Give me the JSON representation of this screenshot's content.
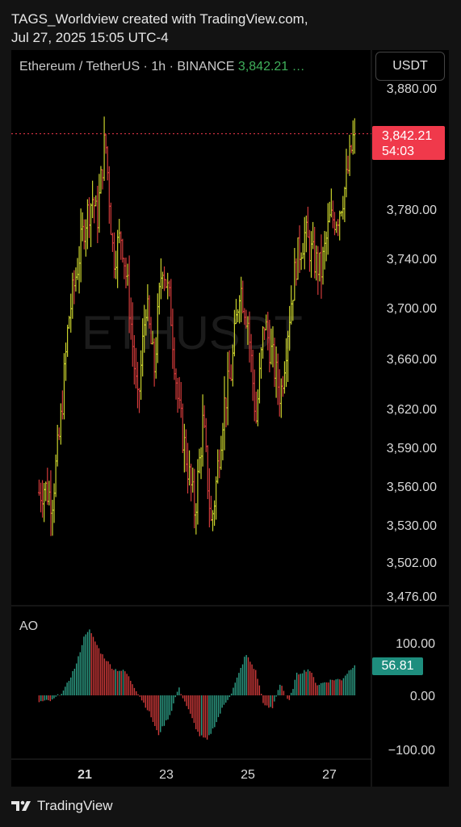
{
  "header": {
    "line1": "TAGS_Worldview created with TradingView.com,",
    "line2": "Jul 27, 2025 15:05 UTC-4"
  },
  "instrument": {
    "label": "Ethereum / TetherUS · 1h · BINANCE",
    "price": "3,842.21 …"
  },
  "currency_button": "USDT",
  "watermark": "ETHUSDT",
  "price_label": {
    "price": "3,842.21",
    "countdown": "54:03"
  },
  "ao": {
    "title": "AO",
    "value_label": "56.81"
  },
  "footer": {
    "brand": "TradingView"
  },
  "colors": {
    "up": "#c9d22c",
    "down": "#d03a3a",
    "rise": "#2e9e86",
    "price_line": "#f0394b"
  },
  "chart_data": [
    {
      "type": "ohlc",
      "title": "Ethereum / TetherUS · 1h · BINANCE",
      "ylabel": "USDT",
      "ylim": [
        3476,
        3880
      ],
      "y_ticks": [
        "3,880.00",
        "3,780.00",
        "3,740.00",
        "3,700.00",
        "3,660.00",
        "3,620.00",
        "3,590.00",
        "3,560.00",
        "3,530.00",
        "3,502.00",
        "3,476.00"
      ],
      "y_tick_values": [
        3880,
        3780,
        3740,
        3700,
        3660,
        3620,
        3590,
        3560,
        3530,
        3502,
        3476
      ],
      "x_ticks": [
        "21",
        "23",
        "25",
        "27"
      ],
      "x_tick_days": [
        21,
        23,
        25,
        27
      ],
      "last_price": 3842.21,
      "close_path": [
        {
          "day": 19.9,
          "close": 3555
        },
        {
          "day": 20.0,
          "close": 3560
        },
        {
          "day": 20.2,
          "close": 3550
        },
        {
          "day": 20.4,
          "close": 3605
        },
        {
          "day": 20.6,
          "close": 3690
        },
        {
          "day": 20.8,
          "close": 3730
        },
        {
          "day": 21.0,
          "close": 3770
        },
        {
          "day": 21.2,
          "close": 3790
        },
        {
          "day": 21.3,
          "close": 3770
        },
        {
          "day": 21.5,
          "close": 3840
        },
        {
          "day": 21.7,
          "close": 3740
        },
        {
          "day": 21.9,
          "close": 3760
        },
        {
          "day": 22.1,
          "close": 3700
        },
        {
          "day": 22.3,
          "close": 3620
        },
        {
          "day": 22.5,
          "close": 3705
        },
        {
          "day": 22.7,
          "close": 3650
        },
        {
          "day": 22.9,
          "close": 3740
        },
        {
          "day": 23.1,
          "close": 3700
        },
        {
          "day": 23.3,
          "close": 3620
        },
        {
          "day": 23.5,
          "close": 3580
        },
        {
          "day": 23.7,
          "close": 3540
        },
        {
          "day": 23.9,
          "close": 3610
        },
        {
          "day": 24.1,
          "close": 3530
        },
        {
          "day": 24.2,
          "close": 3555
        },
        {
          "day": 24.4,
          "close": 3620
        },
        {
          "day": 24.6,
          "close": 3650
        },
        {
          "day": 24.8,
          "close": 3720
        },
        {
          "day": 25.0,
          "close": 3690
        },
        {
          "day": 25.2,
          "close": 3610
        },
        {
          "day": 25.4,
          "close": 3690
        },
        {
          "day": 25.6,
          "close": 3660
        },
        {
          "day": 25.8,
          "close": 3630
        },
        {
          "day": 26.0,
          "close": 3690
        },
        {
          "day": 26.2,
          "close": 3740
        },
        {
          "day": 26.4,
          "close": 3760
        },
        {
          "day": 26.6,
          "close": 3740
        },
        {
          "day": 26.8,
          "close": 3730
        },
        {
          "day": 27.0,
          "close": 3770
        },
        {
          "day": 27.2,
          "close": 3775
        },
        {
          "day": 27.4,
          "close": 3800
        },
        {
          "day": 27.6,
          "close": 3842
        }
      ]
    },
    {
      "type": "bar",
      "title": "AO",
      "ylim": [
        -120,
        165
      ],
      "y_ticks": [
        "100.00",
        "0.00",
        "−100.00"
      ],
      "y_tick_values": [
        100,
        0,
        -100
      ],
      "last_value": 56.81,
      "ao_path": [
        {
          "day": 19.9,
          "value": -12
        },
        {
          "day": 20.2,
          "value": -10
        },
        {
          "day": 20.5,
          "value": 10
        },
        {
          "day": 20.8,
          "value": 60
        },
        {
          "day": 21.0,
          "value": 115
        },
        {
          "day": 21.1,
          "value": 125
        },
        {
          "day": 21.4,
          "value": 80
        },
        {
          "day": 21.7,
          "value": 50
        },
        {
          "day": 22.0,
          "value": 45
        },
        {
          "day": 22.3,
          "value": 5
        },
        {
          "day": 22.6,
          "value": -35
        },
        {
          "day": 22.8,
          "value": -75
        },
        {
          "day": 23.1,
          "value": -35
        },
        {
          "day": 23.3,
          "value": 15
        },
        {
          "day": 23.5,
          "value": -20
        },
        {
          "day": 23.8,
          "value": -75
        },
        {
          "day": 24.0,
          "value": -85
        },
        {
          "day": 24.2,
          "value": -55
        },
        {
          "day": 24.4,
          "value": -20
        },
        {
          "day": 24.6,
          "value": 5
        },
        {
          "day": 24.8,
          "value": 45
        },
        {
          "day": 24.95,
          "value": 78
        },
        {
          "day": 25.2,
          "value": 45
        },
        {
          "day": 25.4,
          "value": -20
        },
        {
          "day": 25.6,
          "value": -25
        },
        {
          "day": 25.8,
          "value": 25
        },
        {
          "day": 26.0,
          "value": -15
        },
        {
          "day": 26.2,
          "value": 40
        },
        {
          "day": 26.5,
          "value": 50
        },
        {
          "day": 26.7,
          "value": 20
        },
        {
          "day": 26.9,
          "value": 25
        },
        {
          "day": 27.1,
          "value": 30
        },
        {
          "day": 27.3,
          "value": 30
        },
        {
          "day": 27.6,
          "value": 57
        }
      ]
    }
  ]
}
